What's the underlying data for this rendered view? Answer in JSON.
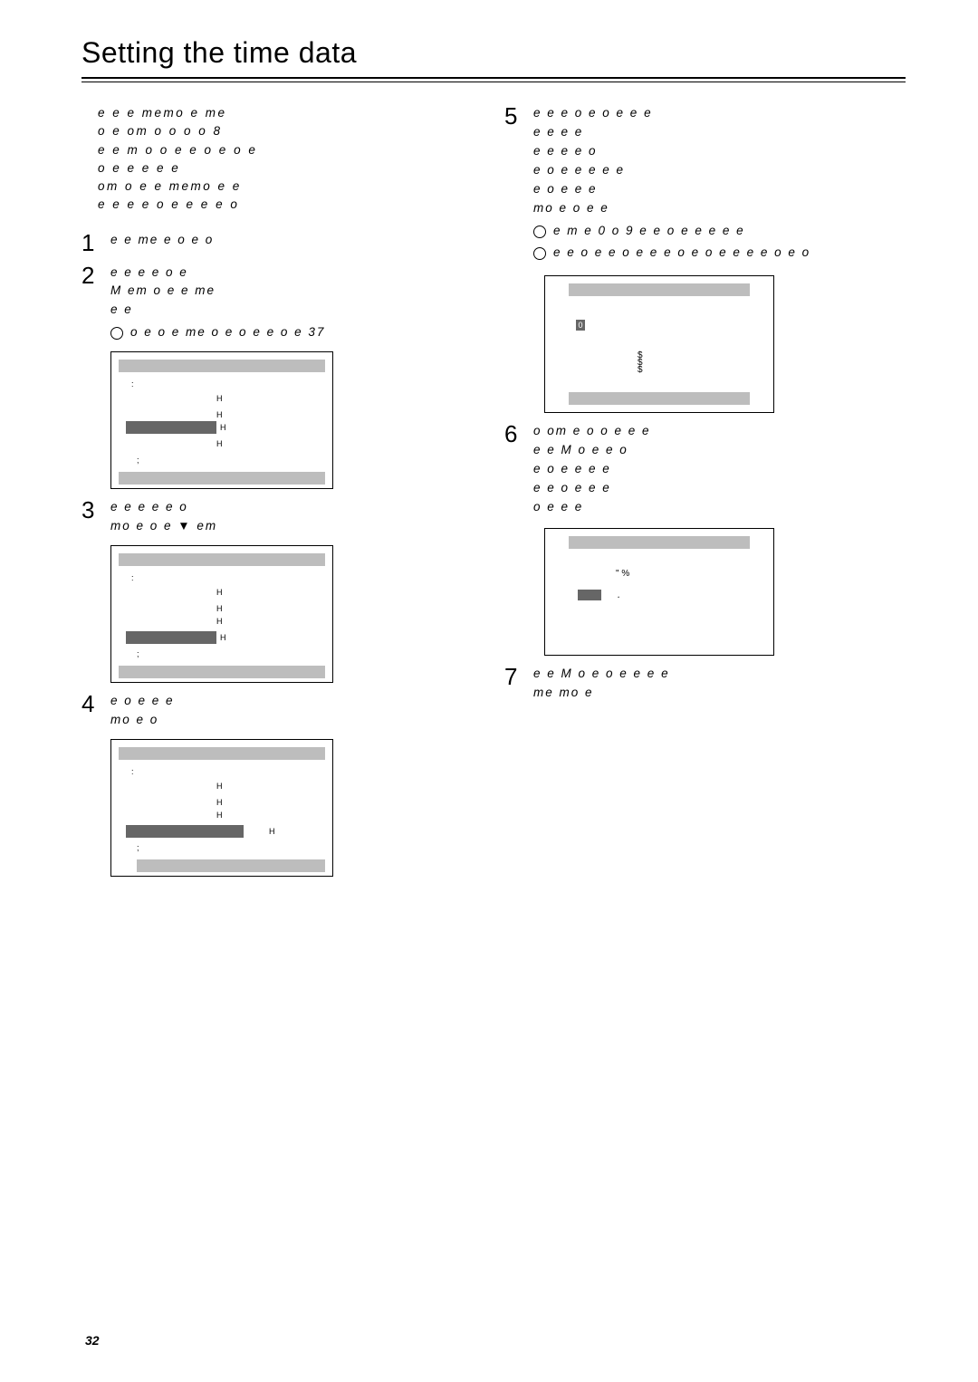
{
  "title": "Setting the time data",
  "page_number": "32",
  "intro_lines": [
    "e      e   e       memo      e    me",
    "o  e     om   o  o          o      o 8",
    "e     e   m    o   o       e e  o  e   o     e",
    " o  e           e     e       e         e",
    " om         o  e      e memo       e     e",
    "e e     e    e  o  e       e e      e   o"
  ],
  "step1": {
    "num": "1",
    "text": "e    e    me    e  o  e                         o"
  },
  "step2": {
    "num": "2",
    "body": [
      "e e                   e   e        o     e",
      "M           em   o       e    e         me",
      "                      e e"
    ],
    "sub1": "o   e      o      e me    o  e    o       e e    o        e 37",
    "screen": {
      "header": ":",
      "rows_h": [
        "H",
        "H",
        "H",
        "H"
      ],
      "row3_hl": true,
      "semi_row": ";"
    }
  },
  "step3": {
    "num": "3",
    "body": [
      "e                   e e       e       e   o",
      "mo e   o   e   ▼          em"
    ],
    "screen": {
      "header": ":",
      "rows_h": [
        "H",
        "H",
        "H",
        "H"
      ],
      "row4_hl": true,
      "semi_row": ";"
    }
  },
  "step4": {
    "num": "4",
    "body": [
      "e          o   e                  e e",
      "mo e       o"
    ],
    "screen": {
      "header": ":",
      "rows_h": [
        "H",
        "H",
        "H",
        "H"
      ],
      "row4_wide_hl": true,
      "semi_row": ";"
    }
  },
  "step5": {
    "num": "5",
    "body": [
      "e     e e      o      e o      e        e       e",
      "e               e                  e e          ",
      "   e                     e  e       e     o",
      "e  o     e e    e     e                  e",
      " e          o  e                  e e",
      "mo e  o    e   e"
    ],
    "sub1": "e    m   e    0  o  9        e e       o     e e       e e                e",
    "sub2": "e        e                                o    e   e   o      e     e e       o       e  o       e    e                e e  o  e o",
    "screen": {
      "tiny_label": "0",
      "dollars": [
        "$",
        "$",
        "$"
      ]
    }
  },
  "step6": {
    "num": "6",
    "body": [
      "o      om   e  o   o      e    e          e",
      " e       e  M             o        e e        o",
      "e  o       e               e                   e e",
      "   e           e   o    e e                 e",
      "  o        e                 e   e"
    ],
    "screen": {
      "line1": "\" %",
      "dot_label": "."
    }
  },
  "step7": {
    "num": "7",
    "body": [
      "e      e  M           o      e  o e e    e    e",
      "me     mo  e"
    ]
  }
}
